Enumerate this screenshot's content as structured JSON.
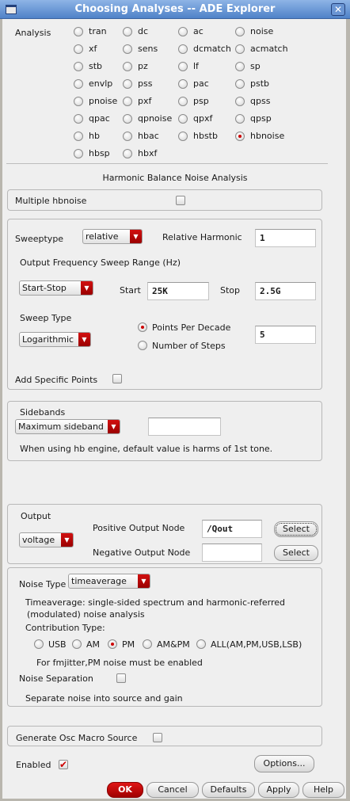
{
  "window": {
    "title": "Choosing Analyses -- ADE Explorer",
    "close": "✕"
  },
  "analysis": {
    "label": "Analysis",
    "selected": "hbnoise",
    "options": [
      "tran",
      "dc",
      "ac",
      "noise",
      "xf",
      "sens",
      "dcmatch",
      "acmatch",
      "stb",
      "pz",
      "lf",
      "sp",
      "envlp",
      "pss",
      "pac",
      "pstb",
      "pnoise",
      "pxf",
      "psp",
      "qpss",
      "qpac",
      "qpnoise",
      "qpxf",
      "qpsp",
      "hb",
      "hbac",
      "hbstb",
      "hbnoise",
      "hbsp",
      "hbxf"
    ]
  },
  "section_title": "Harmonic Balance Noise Analysis",
  "multiple": {
    "label": "Multiple hbnoise",
    "checked": false
  },
  "sweep": {
    "sweeptype_label": "Sweeptype",
    "sweeptype_value": "relative",
    "rel_harm_label": "Relative Harmonic",
    "rel_harm_value": "1",
    "range_label": "Output Frequency Sweep Range (Hz)",
    "range_value": "Start-Stop",
    "start_label": "Start",
    "start_value": "25K",
    "stop_label": "Stop",
    "stop_value": "2.5G",
    "type_label": "Sweep Type",
    "type_value": "Logarithmic",
    "ppd_label": "Points Per Decade",
    "steps_label": "Number of Steps",
    "ppd_value": "5",
    "add_points_label": "Add Specific Points"
  },
  "sidebands": {
    "label": "Sidebands",
    "value": "Maximum sideband",
    "input": "",
    "note": "When using hb engine, default value is harms of 1st tone."
  },
  "output": {
    "label": "Output",
    "value": "voltage",
    "pos_label": "Positive Output Node",
    "pos_value": "/Qout",
    "neg_label": "Negative Output Node",
    "neg_value": "",
    "select": "Select"
  },
  "noise": {
    "type_label": "Noise Type",
    "type_value": "timeaverage",
    "desc1": "Timeaverage: single-sided spectrum and harmonic-referred",
    "desc2": "(modulated) noise analysis",
    "contrib_label": "Contribution Type:",
    "contrib": [
      "USB",
      "AM",
      "PM",
      "AM&PM",
      "ALL(AM,PM,USB,LSB)"
    ],
    "contrib_selected": "PM",
    "fm_note": "For fmjitter,PM noise must be enabled",
    "sep_label": "Noise Separation",
    "sep_note": "Separate noise into source and gain"
  },
  "osc": {
    "label": "Generate Osc Macro Source"
  },
  "enabled": {
    "label": "Enabled",
    "checked": true
  },
  "buttons": {
    "options": "Options...",
    "ok": "OK",
    "cancel": "Cancel",
    "defaults": "Defaults",
    "apply": "Apply",
    "help": "Help"
  }
}
